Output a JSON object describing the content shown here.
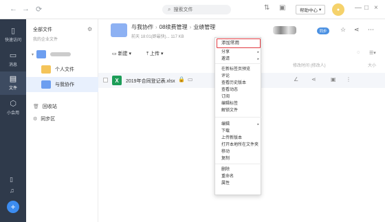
{
  "topbar": {
    "back_icon": "arrow-left-icon",
    "forward_icon": "arrow-right-icon",
    "refresh_icon": "refresh-icon",
    "search_placeholder": "搜索文件",
    "help_label": "帮助中心",
    "help_arrow": "▾",
    "transfer_icon": "transfer-icon",
    "notify_icon": "notify-icon"
  },
  "rail": {
    "items": [
      {
        "label": "快速访问",
        "icon": "quick-access-icon"
      },
      {
        "label": "消息",
        "icon": "message-icon"
      },
      {
        "label": "文件",
        "icon": "file-icon"
      },
      {
        "label": "小会用",
        "icon": "app-icon"
      }
    ],
    "add_label": "+"
  },
  "tree": {
    "header": "全部文件",
    "subheader": "我的企业文件",
    "nodes": [
      {
        "label": "个人文件"
      },
      {
        "label": "与我协作"
      }
    ],
    "recycle": "回收站",
    "sync": "同步区"
  },
  "main": {
    "breadcrumb": [
      "与我协作",
      "08续费管理",
      "业绩管理"
    ],
    "meta": "前天 18:01(即最快)... 117 KB",
    "sync_label": "同步",
    "toolbar": {
      "new_label": "新建",
      "upload_label": "上传"
    },
    "columns": {
      "modified": "修改时间 (修改人)",
      "size": "大小"
    },
    "file": {
      "name": "2019年合同登记表.xlsx",
      "type_letter": "X"
    }
  },
  "context_menu": {
    "highlighted": "添加常用",
    "items": [
      {
        "label": "分享",
        "submenu": true
      },
      {
        "label": "邀请",
        "submenu": true
      },
      {
        "label": "在新标签页预览",
        "submenu": false
      },
      {
        "label": "评论",
        "submenu": false
      },
      {
        "label": "查看历史版本",
        "submenu": false
      },
      {
        "label": "查看动态",
        "submenu": false
      },
      {
        "label": "订阅",
        "submenu": false
      },
      {
        "label": "编辑标签",
        "submenu": false
      },
      {
        "label": "解锁文件",
        "submenu": false
      },
      {
        "label": "编辑",
        "submenu": true
      },
      {
        "label": "下载",
        "submenu": false
      },
      {
        "label": "上传新版本",
        "submenu": false
      },
      {
        "label": "打开本地所在文件夹",
        "submenu": false
      },
      {
        "label": "移动",
        "submenu": false
      },
      {
        "label": "复制",
        "submenu": false
      },
      {
        "label": "删除",
        "submenu": false
      },
      {
        "label": "重命名",
        "submenu": false
      },
      {
        "label": "属性",
        "submenu": false
      }
    ]
  },
  "colors": {
    "rail_bg": "#2f3a4b",
    "accent": "#3c8cf0",
    "highlight_border": "#e0383e",
    "excel_green": "#1d9d58"
  }
}
